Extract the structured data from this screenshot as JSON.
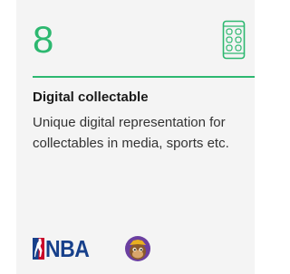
{
  "card": {
    "number": "8",
    "title": "Digital collectable",
    "description": "Unique digital representation for collectables in media, sports etc.",
    "logos": {
      "nba": "NBA",
      "ape": "ape-avatar-icon"
    },
    "icon": "smartphone-apps-icon",
    "colors": {
      "accent": "#2db870",
      "background": "#f4f4f4",
      "nba_blue": "#17408b",
      "nba_red": "#c9082a"
    }
  }
}
